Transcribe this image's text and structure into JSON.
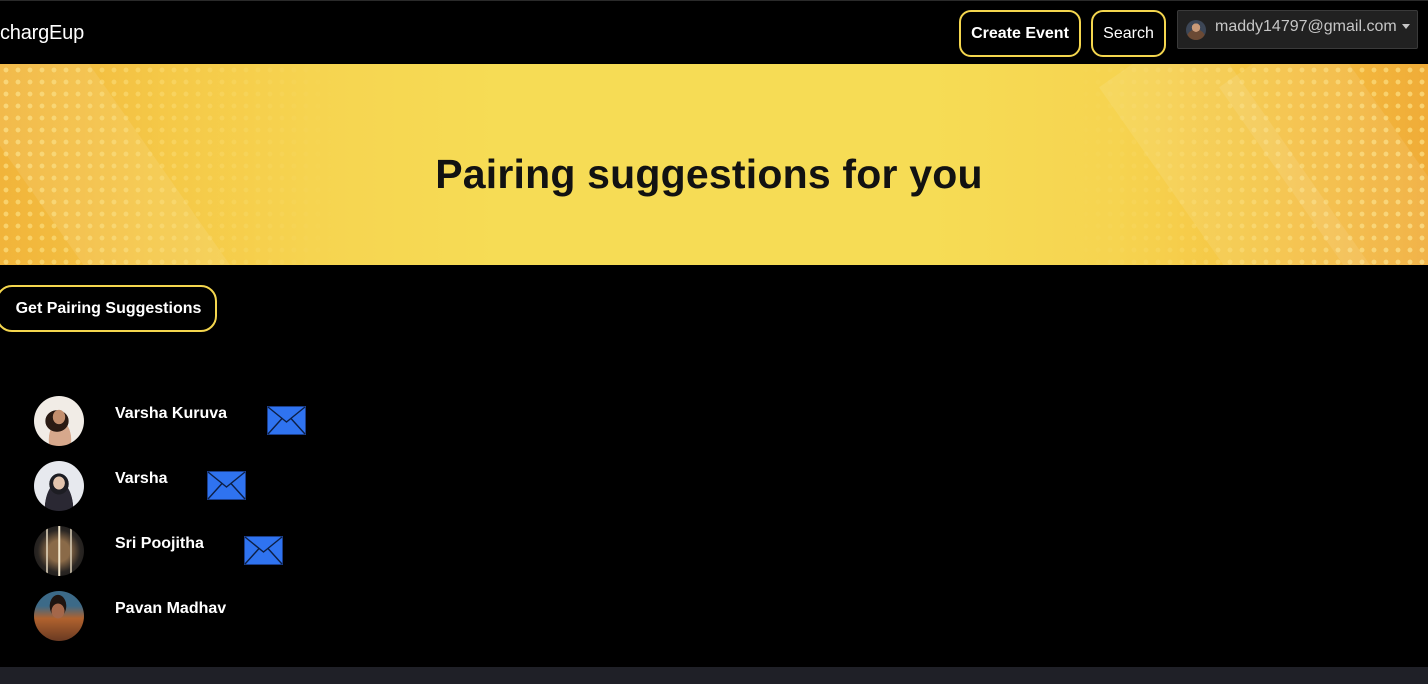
{
  "navbar": {
    "brand": "chargEup",
    "create_event_label": "Create Event",
    "search_label": "Search",
    "user_email": "maddy14797@gmail.com"
  },
  "banner": {
    "title": "Pairing suggestions for you"
  },
  "main": {
    "get_suggestions_label": "Get Pairing Suggestions",
    "suggestions": [
      {
        "name": "Varsha Kuruva",
        "has_message_icon": true
      },
      {
        "name": "Varsha",
        "has_message_icon": true
      },
      {
        "name": "Sri Poojitha",
        "has_message_icon": true
      },
      {
        "name": "Pavan Madhav",
        "has_message_icon": false
      }
    ]
  },
  "colors": {
    "accent": "#f4d64e",
    "background": "#000000",
    "banner_yellow": "#f6dc55",
    "mail_icon_blue": "#2f73f0"
  }
}
